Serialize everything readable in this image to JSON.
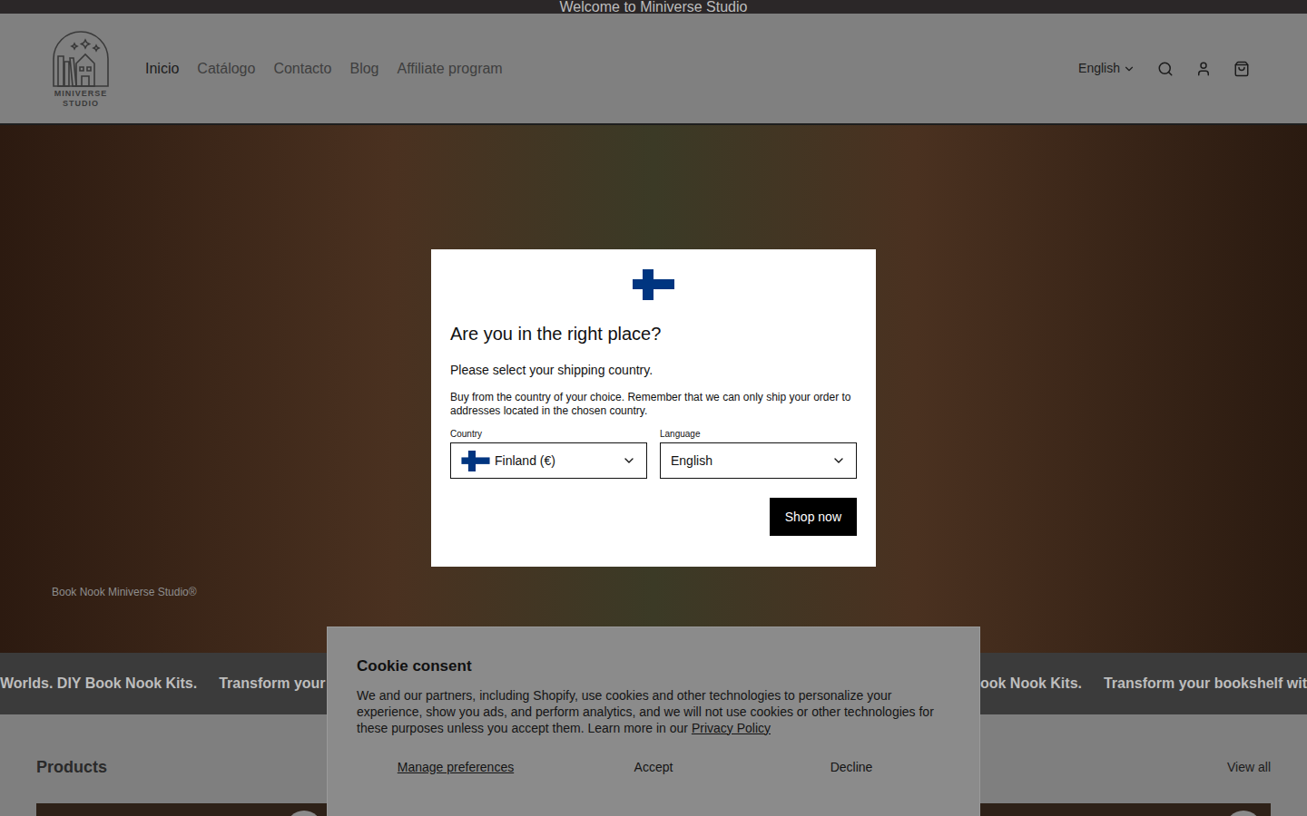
{
  "announcement": "Welcome to Miniverse Studio",
  "logo": {
    "line1": "MINIVERSE",
    "line2": "STUDIO"
  },
  "nav": [
    {
      "label": "Inicio",
      "selected": true
    },
    {
      "label": "Catálogo",
      "selected": false
    },
    {
      "label": "Contacto",
      "selected": false
    },
    {
      "label": "Blog",
      "selected": false
    },
    {
      "label": "Affiliate program",
      "selected": false
    }
  ],
  "language_selector": "English",
  "hero": {
    "caption": "Book Nook Miniverse Studio®"
  },
  "marquee": {
    "left": [
      "Worlds. DIY Book Nook Kits.",
      "Transform your bo"
    ],
    "right": [
      "Y Book Nook Kits.",
      "Transform your bookshelf wit"
    ]
  },
  "products": {
    "title": "Products",
    "link": "View all"
  },
  "modal": {
    "title": "Are you in the right place?",
    "subtitle": "Please select your shipping country.",
    "note": "Buy from the country of your choice. Remember that we can only ship your order to addresses located in the chosen country.",
    "country_label": "Country",
    "country": "Finland (€)",
    "language_label": "Language",
    "language": "English",
    "button": "Shop now"
  },
  "cookie": {
    "title": "Cookie consent",
    "text": "We and our partners, including Shopify, use cookies and other technologies to personalize your experience, show you ads, and perform analytics, and we will not use cookies or other technologies for these purposes unless you accept them. Learn more in our",
    "link": "Privacy Policy",
    "buttons": [
      "Manage preferences",
      "Accept",
      "Decline"
    ]
  }
}
